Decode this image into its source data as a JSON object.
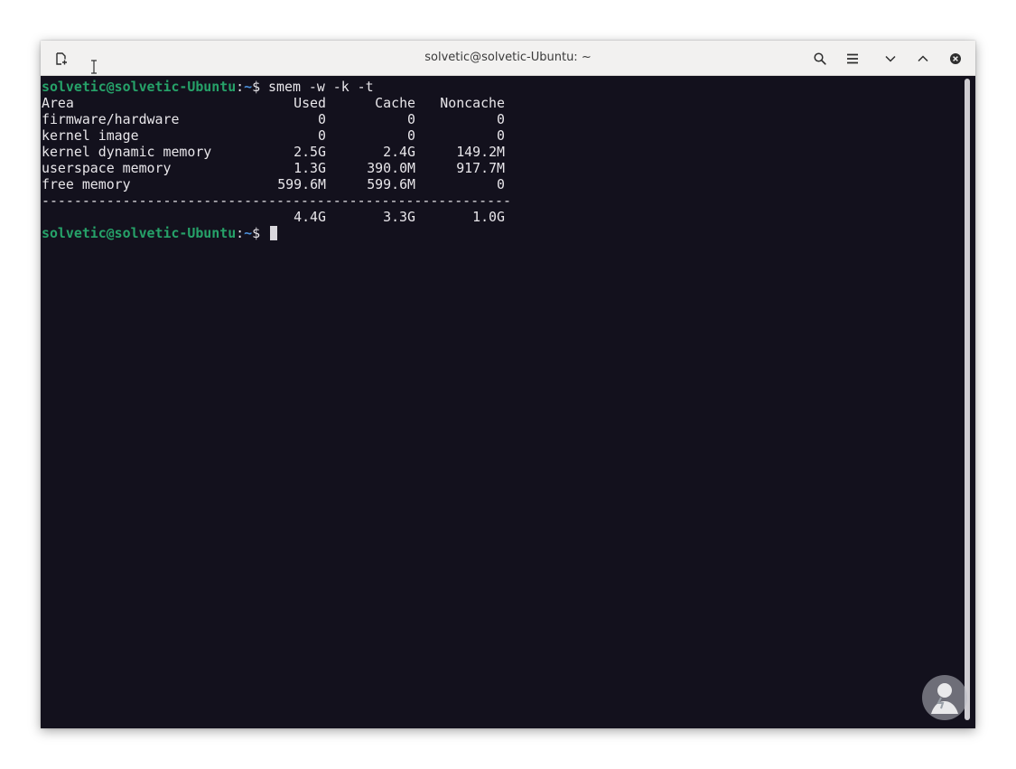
{
  "window": {
    "title": "solvetic@solvetic-Ubuntu: ~"
  },
  "toolbar": {
    "new_tab_icon": "new-tab-icon",
    "search_icon": "search-icon",
    "menu_icon": "hamburger-menu-icon",
    "minimize_icon": "chevron-down-icon",
    "maximize_icon": "chevron-up-icon",
    "close_icon": "close-icon"
  },
  "terminal": {
    "prompt_user": "solvetic@solvetic-Ubuntu",
    "prompt_sep": ":",
    "prompt_path": "~",
    "prompt_symbol": "$ ",
    "command": "smem -w -k -t",
    "headers": {
      "area": "Area",
      "used": "Used",
      "cache": "Cache",
      "noncache": "Noncache"
    },
    "rows": [
      {
        "area": "firmware/hardware",
        "used": "0",
        "cache": "0",
        "noncache": "0"
      },
      {
        "area": "kernel image",
        "used": "0",
        "cache": "0",
        "noncache": "0"
      },
      {
        "area": "kernel dynamic memory",
        "used": "2.5G",
        "cache": "2.4G",
        "noncache": "149.2M"
      },
      {
        "area": "userspace memory",
        "used": "1.3G",
        "cache": "390.0M",
        "noncache": "917.7M"
      },
      {
        "area": "free memory",
        "used": "599.6M",
        "cache": "599.6M",
        "noncache": "0"
      }
    ],
    "separator": "----------------------------------------------------------",
    "totals": {
      "area": "",
      "used": "4.4G",
      "cache": "3.3G",
      "noncache": "1.0G"
    }
  },
  "colors": {
    "terminal_bg": "#13111d",
    "prompt_user": "#26a269",
    "prompt_path": "#4b8fd9",
    "text": "#e8e6ea",
    "titlebar_bg": "#f2f1f0"
  }
}
